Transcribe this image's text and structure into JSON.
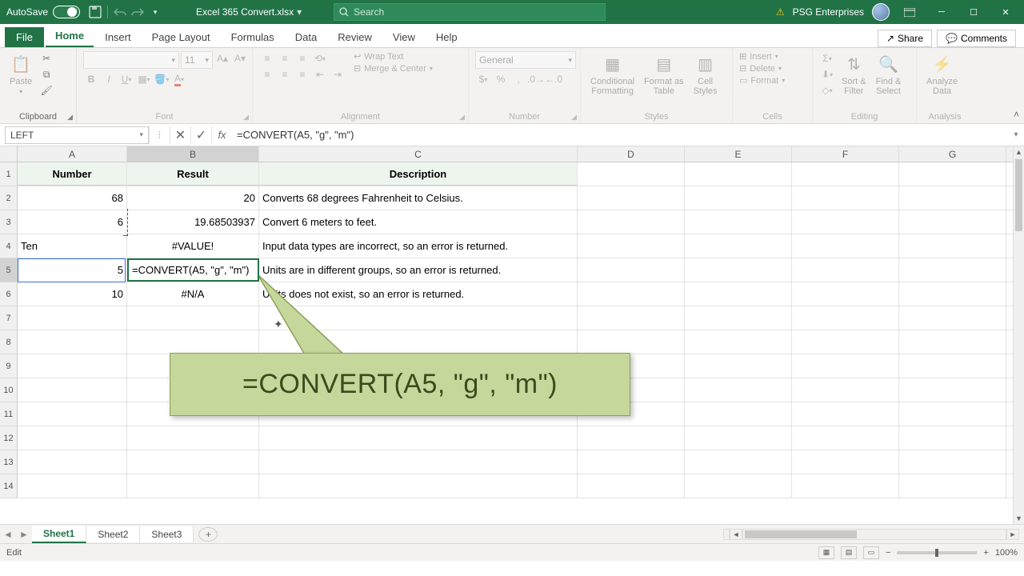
{
  "titlebar": {
    "autosave_label": "AutoSave",
    "autosave_state": "Off",
    "doc_name": "Excel 365 Convert.xlsx",
    "search_placeholder": "Search",
    "user_name": "PSG Enterprises"
  },
  "menu": {
    "file": "File",
    "tabs": [
      "Home",
      "Insert",
      "Page Layout",
      "Formulas",
      "Data",
      "Review",
      "View",
      "Help"
    ],
    "active_tab": "Home",
    "share": "Share",
    "comments": "Comments"
  },
  "ribbon": {
    "clipboard": {
      "paste": "Paste",
      "label": "Clipboard"
    },
    "font": {
      "name": "",
      "size": "11",
      "label": "Font"
    },
    "alignment": {
      "wrap": "Wrap Text",
      "merge": "Merge & Center",
      "label": "Alignment"
    },
    "number": {
      "format": "General",
      "label": "Number"
    },
    "styles": {
      "cond": "Conditional\nFormatting",
      "tbl": "Format as\nTable",
      "cell": "Cell\nStyles",
      "label": "Styles"
    },
    "cells": {
      "insert": "Insert",
      "delete": "Delete",
      "format": "Format",
      "label": "Cells"
    },
    "editing": {
      "sort": "Sort &\nFilter",
      "find": "Find &\nSelect",
      "label": "Editing"
    },
    "analysis": {
      "analyze": "Analyze\nData",
      "label": "Analysis"
    }
  },
  "formula_bar": {
    "name_box": "LEFT",
    "formula": "=CONVERT(A5, \"g\", \"m\")"
  },
  "columns": [
    "A",
    "B",
    "C",
    "D",
    "E",
    "F",
    "G"
  ],
  "row_numbers": [
    "1",
    "2",
    "3",
    "4",
    "5",
    "6",
    "7",
    "8",
    "9",
    "10",
    "11",
    "12",
    "13",
    "14"
  ],
  "headers": {
    "a": "Number",
    "b": "Result",
    "c": "Description"
  },
  "data": {
    "r2": {
      "a": "68",
      "b": "20",
      "c": "Converts 68 degrees Fahrenheit to Celsius."
    },
    "r3": {
      "a": "6",
      "b": "19.68503937",
      "c": "Convert 6 meters to feet."
    },
    "r4": {
      "a": "Ten",
      "b": "#VALUE!",
      "c": "Input data types are incorrect, so an error is returned."
    },
    "r5": {
      "a": "5",
      "b": "=CONVERT(A5, \"g\", \"m\")",
      "c": "Units are in different groups, so an error is returned."
    },
    "r6": {
      "a": "10",
      "b": "#N/A",
      "c": "Units does not exist, so an error is returned."
    }
  },
  "callout": {
    "text": "=CONVERT(A5, \"g\", \"m\")"
  },
  "sheets": {
    "tabs": [
      "Sheet1",
      "Sheet2",
      "Sheet3"
    ],
    "active": "Sheet1"
  },
  "status": {
    "mode": "Edit",
    "zoom": "100%"
  }
}
